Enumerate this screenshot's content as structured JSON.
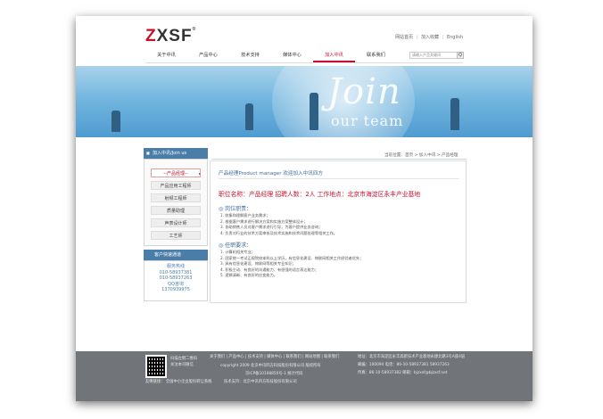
{
  "header": {
    "logo": "ZXSF",
    "logo_mark": "®",
    "links": [
      "网站首页",
      "加入收藏",
      "English"
    ]
  },
  "nav": {
    "items": [
      "关于中讯",
      "产品中心",
      "技术支持",
      "媒体中心",
      "加入中讯",
      "联系我们"
    ],
    "active_index": 4
  },
  "search": {
    "placeholder": "请输入产品关键词",
    "button": "Q"
  },
  "banner": {
    "line1": "Join",
    "line2": "our team"
  },
  "sidebar": {
    "title": "加入中讯/Join us",
    "items": [
      "产品经理",
      "产品应用工程师",
      "射频工程师",
      "质量助理",
      "声表设计师",
      "工艺师"
    ],
    "active_item": "--产品经理--"
  },
  "contact": {
    "title": "客户快速通道",
    "lines": [
      "服务热线",
      "010-58937381",
      "010-58937263",
      "QQ咨询",
      "1370939975"
    ]
  },
  "breadcrumb": "当前位置：首页 > 加入中讯 > 产品经理",
  "content": {
    "title": "产品经理Product manager 欢迎加入中讯四方",
    "job_line": "职位名称：产品经理    招聘人数：2人    工作地点：北京市海淀区永丰产业基地",
    "duties_title": "岗位职责：",
    "duties": [
      "1. 收集和理解客户业务需求；",
      "2. 根据客户需求进行解决方案和实施方案整体设计；",
      "3. 协助销售人员对客户需求进行引导，为客户提供业务咨询；",
      "4. 负责对行业的技术方案审核及技术实施和技术问题处理等相关工作。"
    ],
    "req_title": "任职要求：",
    "requirements": [
      "1. 计算机相关专业；",
      "2. 国家统一考试正规院校本科以上学历，有信息化建设、物联网相关工作经验者优先；",
      "3. 具有信息化建设、物联网等相关专业知识；",
      "4. 积极主动、有良好的沟通能力、有很强的语言表达能力；",
      "5. 逻辑清晰、有良好的应变能力。"
    ]
  },
  "footer": {
    "qr_caption": [
      "扫描左侧二维码",
      "关注本司微信"
    ],
    "links": "关于我们 | 产品中心 | 技术支持 | 媒体中心 | 联系我们 | 网站地图 | 联系我们",
    "copyright": "copyright 2009 北京中讯四方科技股份有限公司 版权所有",
    "icp": "京ICP备10108850号-1 统计代码",
    "tech": "技术支持：北京中讯四方科技股份有限公司",
    "friend_links": "友情链接：   全国中小企业股份转让系统",
    "address": "地址：北京市海淀区永丰高新技术产业基地永捷北路3号A座4层",
    "postcode": "邮编：100094   电话：86-10-58937381 58937263",
    "fax": "传真：86-10-58937382   邮箱：bjzxsf@bjzxsf.net"
  },
  "colors": {
    "accent": "#c8102e",
    "blue": "#4a7ea8",
    "footer": "#717579"
  }
}
